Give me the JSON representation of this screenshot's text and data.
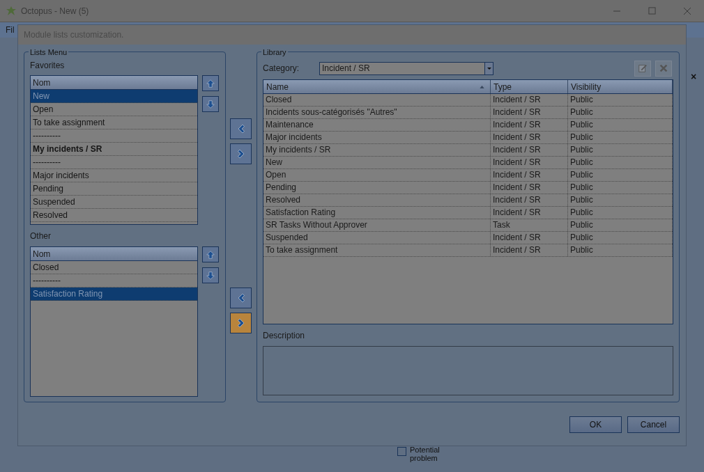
{
  "window": {
    "title": "Octopus - New (5)",
    "menu": [
      "Fil"
    ]
  },
  "background": {
    "close_glyph": "×",
    "checkbox": {
      "label": "Potential problem",
      "checked": false
    }
  },
  "dialog": {
    "title": "Module lists customization.",
    "lists_menu": {
      "title": "Lists Menu",
      "favorites": {
        "label": "Favorites",
        "column": "Nom",
        "items": [
          {
            "text": "New",
            "selected": true,
            "bold": false
          },
          {
            "text": "Open",
            "selected": false,
            "bold": false
          },
          {
            "text": "To take assignment",
            "selected": false,
            "bold": false
          },
          {
            "text": "----------",
            "selected": false,
            "bold": false
          },
          {
            "text": "My incidents / SR",
            "selected": false,
            "bold": true
          },
          {
            "text": "----------",
            "selected": false,
            "bold": false
          },
          {
            "text": "Major incidents",
            "selected": false,
            "bold": false
          },
          {
            "text": "Pending",
            "selected": false,
            "bold": false
          },
          {
            "text": "Suspended",
            "selected": false,
            "bold": false
          },
          {
            "text": "Resolved",
            "selected": false,
            "bold": false
          }
        ]
      },
      "other": {
        "label": "Other",
        "column": "Nom",
        "items": [
          {
            "text": "Closed",
            "selected": false,
            "bold": false
          },
          {
            "text": "----------",
            "selected": false,
            "bold": false
          },
          {
            "text": "Satisfaction Rating",
            "selected": true,
            "bold": false
          }
        ]
      }
    },
    "transfer_buttons": [
      [
        {
          "kind": "left",
          "highlighted": false
        },
        {
          "kind": "right",
          "highlighted": false
        }
      ],
      [
        {
          "kind": "left",
          "highlighted": false
        },
        {
          "kind": "right",
          "highlighted": true
        }
      ]
    ],
    "library": {
      "title": "Library",
      "category_label": "Category:",
      "category": "Incident / SR",
      "columns": [
        {
          "label": "Name",
          "sorted": true
        },
        {
          "label": "Type",
          "sorted": false
        },
        {
          "label": "Visibility",
          "sorted": false
        }
      ],
      "rows": [
        [
          "Closed",
          "Incident / SR",
          "Public"
        ],
        [
          "Incidents sous-catégorisés \"Autres\"",
          "Incident / SR",
          "Public"
        ],
        [
          "Maintenance",
          "Incident / SR",
          "Public"
        ],
        [
          "Major incidents",
          "Incident / SR",
          "Public"
        ],
        [
          "My incidents / SR",
          "Incident / SR",
          "Public"
        ],
        [
          "New",
          "Incident / SR",
          "Public"
        ],
        [
          "Open",
          "Incident / SR",
          "Public"
        ],
        [
          "Pending",
          "Incident / SR",
          "Public"
        ],
        [
          "Resolved",
          "Incident / SR",
          "Public"
        ],
        [
          "Satisfaction Rating",
          "Incident / SR",
          "Public"
        ],
        [
          "SR Tasks Without Approver",
          "Task",
          "Public"
        ],
        [
          "Suspended",
          "Incident / SR",
          "Public"
        ],
        [
          "To take assignment",
          "Incident / SR",
          "Public"
        ]
      ],
      "description_label": "Description"
    },
    "buttons": [
      "OK",
      "Cancel"
    ]
  }
}
